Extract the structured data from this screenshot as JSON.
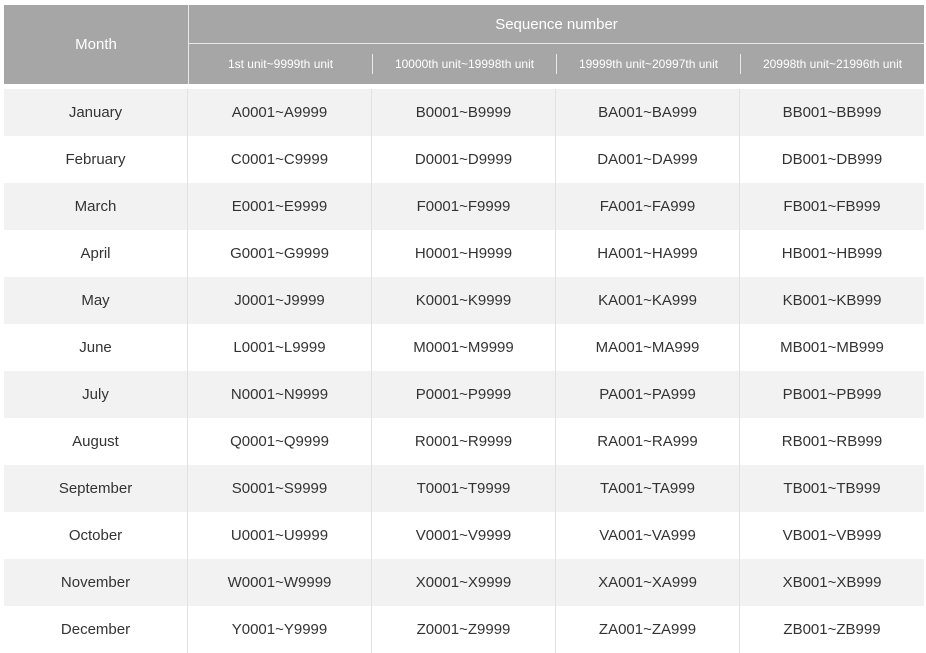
{
  "header": {
    "month": "Month",
    "group": "Sequence number",
    "columns": [
      "1st unit~9999th unit",
      "10000th unit~19998th unit",
      "19999th unit~20997th unit",
      "20998th unit~21996th unit"
    ]
  },
  "rows": [
    {
      "month": "January",
      "c1": "A0001~A9999",
      "c2": "B0001~B9999",
      "c3": "BA001~BA999",
      "c4": "BB001~BB999"
    },
    {
      "month": "February",
      "c1": "C0001~C9999",
      "c2": "D0001~D9999",
      "c3": "DA001~DA999",
      "c4": "DB001~DB999"
    },
    {
      "month": "March",
      "c1": "E0001~E9999",
      "c2": "F0001~F9999",
      "c3": "FA001~FA999",
      "c4": "FB001~FB999"
    },
    {
      "month": "April",
      "c1": "G0001~G9999",
      "c2": "H0001~H9999",
      "c3": "HA001~HA999",
      "c4": "HB001~HB999"
    },
    {
      "month": "May",
      "c1": "J0001~J9999",
      "c2": "K0001~K9999",
      "c3": "KA001~KA999",
      "c4": "KB001~KB999"
    },
    {
      "month": "June",
      "c1": "L0001~L9999",
      "c2": "M0001~M9999",
      "c3": "MA001~MA999",
      "c4": "MB001~MB999"
    },
    {
      "month": "July",
      "c1": "N0001~N9999",
      "c2": "P0001~P9999",
      "c3": "PA001~PA999",
      "c4": "PB001~PB999"
    },
    {
      "month": "August",
      "c1": "Q0001~Q9999",
      "c2": "R0001~R9999",
      "c3": "RA001~RA999",
      "c4": "RB001~RB999"
    },
    {
      "month": "September",
      "c1": "S0001~S9999",
      "c2": "T0001~T9999",
      "c3": "TA001~TA999",
      "c4": "TB001~TB999"
    },
    {
      "month": "October",
      "c1": "U0001~U9999",
      "c2": "V0001~V9999",
      "c3": "VA001~VA999",
      "c4": "VB001~VB999"
    },
    {
      "month": "November",
      "c1": "W0001~W9999",
      "c2": "X0001~X9999",
      "c3": "XA001~XA999",
      "c4": "XB001~XB999"
    },
    {
      "month": "December",
      "c1": "Y0001~Y9999",
      "c2": "Z0001~Z9999",
      "c3": "ZA001~ZA999",
      "c4": "ZB001~ZB999"
    }
  ],
  "colors": {
    "header_bg": "#a6a6a6",
    "header_text": "#ffffff",
    "row_stripe": "#f2f2f2",
    "row_plain": "#ffffff",
    "cell_text": "#333333"
  }
}
